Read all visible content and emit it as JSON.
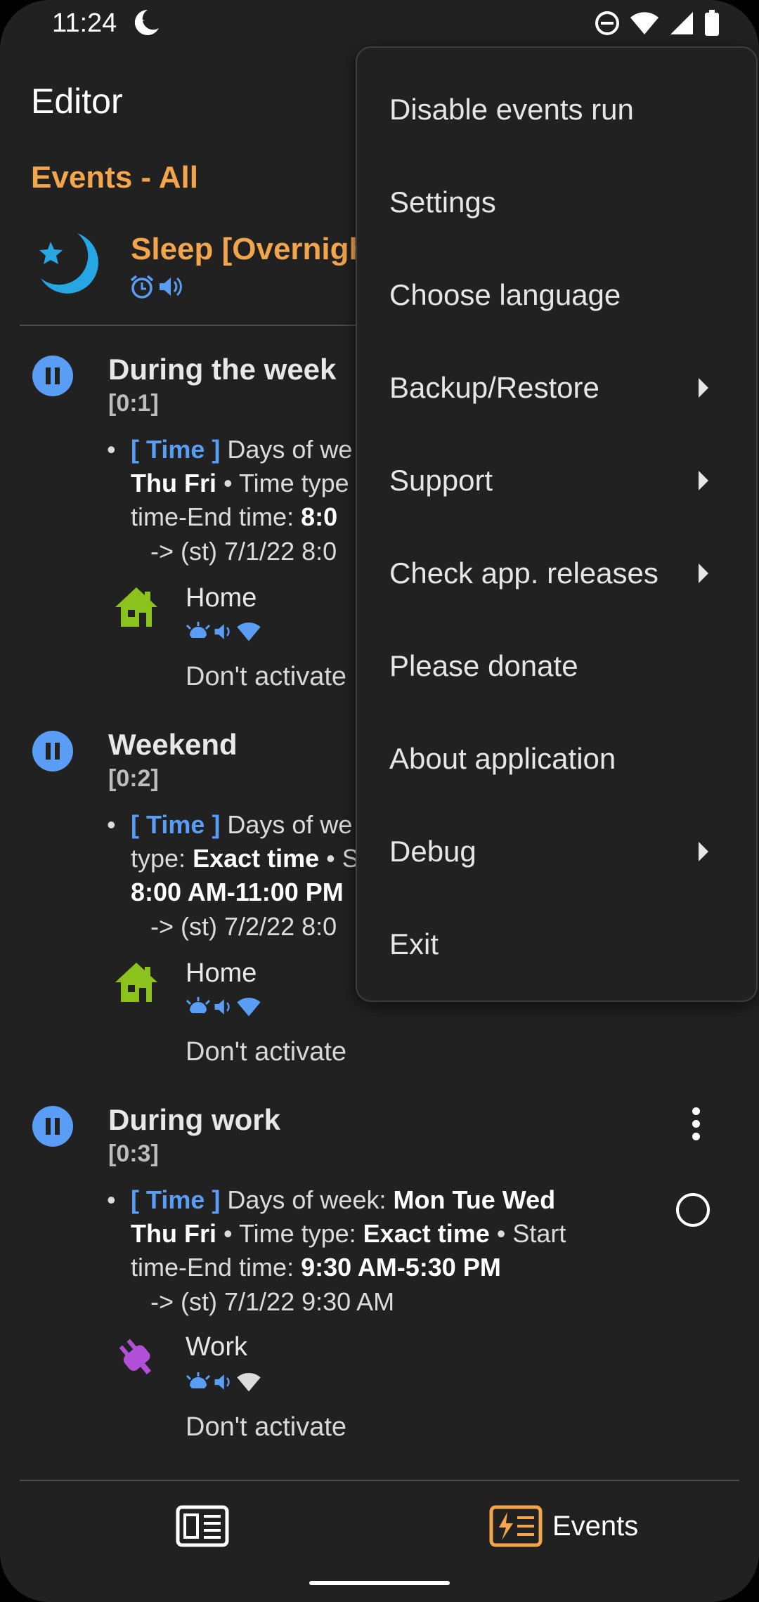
{
  "status_bar": {
    "time": "11:24"
  },
  "app_bar": {
    "title": "Editor"
  },
  "section": {
    "title": "Events - All"
  },
  "active_profile": {
    "name": "Sleep [Overnight"
  },
  "events": [
    {
      "name": "During the week",
      "number": "[0:1]",
      "tag": "[ Time ]",
      "desc_pre": "Days of we",
      "desc_bold1": "Thu Fri",
      "desc_mid": "• Time type",
      "desc_line3": "time-End time: ",
      "desc_bold2": "8:0",
      "schedule": "-> (st) 7/1/22 8:0",
      "profile": "Home",
      "status": "Don't activate"
    },
    {
      "name": "Weekend",
      "number": "[0:2]",
      "tag": "[ Time ]",
      "desc_pre": "Days of we",
      "desc_type_label": "type: ",
      "desc_bold1": "Exact time",
      "desc_mid": "• S",
      "desc_bold2": "8:00 AM-11:00 PM",
      "schedule": "-> (st) 7/2/22 8:0",
      "profile": "Home",
      "status": "Don't activate"
    },
    {
      "name": "During work",
      "number": "[0:3]",
      "tag": "[ Time ]",
      "desc_pre": "Days of week: ",
      "desc_days1": "Mon Tue Wed",
      "desc_days2": "Thu Fri",
      "desc_type": "• Time type: ",
      "desc_type_val": "Exact time",
      "desc_start": "• Start",
      "desc_line3": "time-End time: ",
      "desc_time": "9:30 AM-5:30 PM",
      "schedule": "-> (st) 7/1/22 9:30 AM",
      "profile": "Work",
      "status": "Don't activate"
    }
  ],
  "menu": {
    "items": [
      {
        "label": "Disable events run",
        "submenu": false
      },
      {
        "label": "Settings",
        "submenu": false
      },
      {
        "label": "Choose language",
        "submenu": false
      },
      {
        "label": "Backup/Restore",
        "submenu": true
      },
      {
        "label": "Support",
        "submenu": true
      },
      {
        "label": "Check app. releases",
        "submenu": true
      },
      {
        "label": "Please donate",
        "submenu": false
      },
      {
        "label": "About application",
        "submenu": false
      },
      {
        "label": "Debug",
        "submenu": true
      },
      {
        "label": "Exit",
        "submenu": false
      }
    ]
  },
  "bottom_nav": {
    "events_label": "Events"
  },
  "colors": {
    "accent_orange": "#f3a54c",
    "accent_blue": "#5a9df5",
    "background": "#212121",
    "home_green": "#8bc21c",
    "work_purple": "#b14fd9"
  },
  "icons": [
    "moon-icon",
    "do-not-disturb-icon",
    "wifi-icon",
    "signal-icon",
    "battery-icon",
    "alarm-icon",
    "volume-icon",
    "pause-icon",
    "house-icon",
    "plug-icon",
    "vibrate-icon",
    "more-vert-icon",
    "radio-icon",
    "editor-icon",
    "events-icon",
    "submenu-arrow-icon"
  ]
}
